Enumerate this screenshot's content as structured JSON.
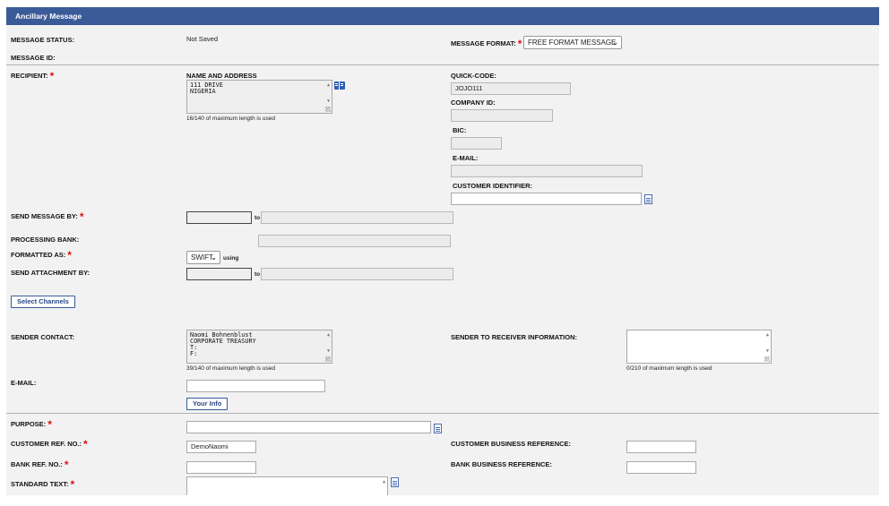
{
  "header": {
    "title": "Ancillary Message"
  },
  "message_status": {
    "label": "MESSAGE STATUS:",
    "value": "Not Saved"
  },
  "message_format": {
    "label": "MESSAGE FORMAT:",
    "selected": "FREE FORMAT MESSAGE"
  },
  "message_id": {
    "label": "MESSAGE ID:"
  },
  "recipient": {
    "label": "RECIPIENT:",
    "name_address_label": "NAME AND ADDRESS",
    "name_address_value": "111 DRIVE\nNIGERIA",
    "length_note": "16/140 of maximum length is used",
    "quick_code_label": "QUICK-CODE:",
    "quick_code_value": "JOJO111",
    "company_id_label": "COMPANY ID:",
    "bic_label": "BIC:",
    "email_label": "E-MAIL:",
    "customer_identifier_label": "CUSTOMER IDENTIFIER:"
  },
  "send_message_by": {
    "label": "SEND MESSAGE BY:",
    "to": "to"
  },
  "processing_bank": {
    "label": "PROCESSING BANK:"
  },
  "formatted_as": {
    "label": "FORMATTED AS:",
    "selected": "SWIFT",
    "using": "using"
  },
  "send_attachment_by": {
    "label": "SEND ATTACHMENT BY:",
    "to": "to"
  },
  "select_channels_button": "Select Channels",
  "sender_contact": {
    "label": "SENDER CONTACT:",
    "value": "Naomi Bohnenblust\nCORPORATE TREASURY\nT:\nF:",
    "length_note": "39/140 of maximum length is used"
  },
  "sender_to_receiver": {
    "label": "SENDER TO RECEIVER INFORMATION:",
    "length_note": "0/210 of maximum length is used"
  },
  "email": {
    "label": "E-MAIL:"
  },
  "your_info_button": "Your Info",
  "purpose": {
    "label": "PURPOSE:"
  },
  "customer_ref": {
    "label": "CUSTOMER REF. NO.:",
    "value": "DemoNaomi"
  },
  "customer_business_ref": {
    "label": "CUSTOMER BUSINESS REFERENCE:"
  },
  "bank_ref": {
    "label": "BANK REF. NO.:"
  },
  "bank_business_ref": {
    "label": "BANK BUSINESS REFERENCE:"
  },
  "standard_text": {
    "label": "STANDARD TEXT:"
  },
  "colors": {
    "header": "#3a5a98",
    "required": "#e01010",
    "panel": "#f2f2f2"
  }
}
